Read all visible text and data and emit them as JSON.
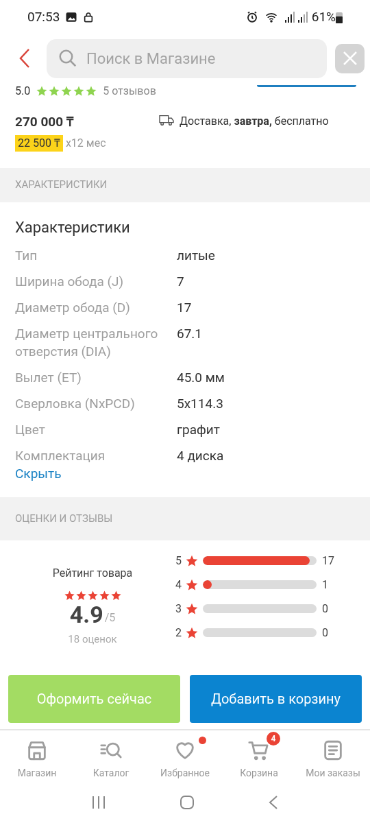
{
  "status_bar": {
    "time": "07:53",
    "battery": "61%"
  },
  "search": {
    "placeholder": "Поиск в Магазине"
  },
  "product": {
    "rating": "5.0",
    "stars": 5,
    "reviews": "5 отзывов",
    "price": "270 000 ₸",
    "installment": "22 500 ₸",
    "installment_term": "x12 мес",
    "delivery": "Доставка, **завтра,** бесплатно"
  },
  "specs_section": {
    "header": "ХАРАКТЕРИСТИКИ",
    "title": "Характеристики",
    "rows": [
      {
        "label": "Тип",
        "value": "литые"
      },
      {
        "label": "Ширина обода (J)",
        "value": "7"
      },
      {
        "label": "Диаметр обода (D)",
        "value": "17"
      },
      {
        "label": "Диаметр центрального отверстия (DIA)",
        "value": "67.1"
      },
      {
        "label": "Вылет (ET)",
        "value": "45.0 мм"
      },
      {
        "label": "Сверловка (NxPCD)",
        "value": "5x114.3"
      },
      {
        "label": "Цвет",
        "value": "графит"
      },
      {
        "label": "Комплектация",
        "value": "4 диска"
      }
    ],
    "hide_link": "Скрыть"
  },
  "reviews_section": {
    "header": "ОЦЕНКИ И ОТЗЫВЫ",
    "rating_title": "Рейтинг товара",
    "stars": 5,
    "score": "4.9",
    "score_max": "/5",
    "count": "18 оценок",
    "bars": [
      {
        "star": "5",
        "count": "17",
        "level": 0.94
      },
      {
        "star": "4",
        "count": "1",
        "level": 0.05
      },
      {
        "star": "3",
        "count": "0",
        "level": 0
      },
      {
        "star": "2",
        "count": "0",
        "level": 0
      }
    ]
  },
  "actions": {
    "checkout": "Оформить сейчас",
    "add_to_cart": "Добавить в корзину"
  },
  "bottom_nav": [
    {
      "kind": "store",
      "label": "Магазин",
      "dot": false
    },
    {
      "kind": "catalog",
      "label": "Каталог",
      "dot": false
    },
    {
      "kind": "favorites",
      "label": "Избранное",
      "dot": true
    },
    {
      "kind": "cart",
      "label": "Корзина",
      "dot": false,
      "badge": "4"
    },
    {
      "kind": "orders",
      "label": "Мои заказы",
      "dot": false
    }
  ]
}
